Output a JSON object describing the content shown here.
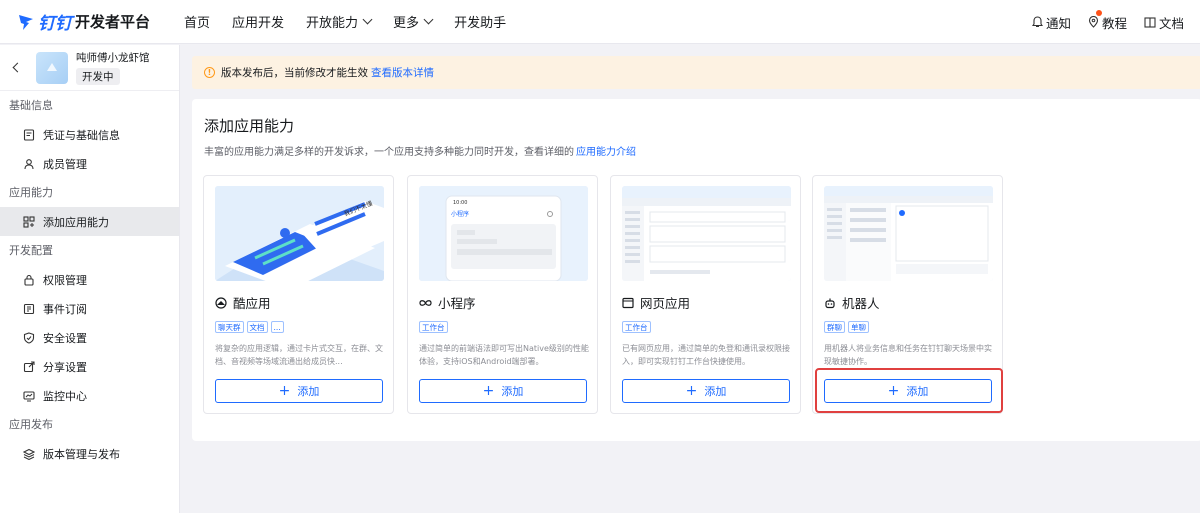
{
  "brand": {
    "name": "钉钉",
    "title": "开发者平台",
    "color": "#1f6bff"
  },
  "nav": {
    "items": [
      {
        "label": "首页",
        "dropdown": false
      },
      {
        "label": "应用开发",
        "dropdown": false
      },
      {
        "label": "开放能力",
        "dropdown": true
      },
      {
        "label": "更多",
        "dropdown": true
      },
      {
        "label": "开发助手",
        "dropdown": false
      }
    ],
    "right": {
      "notify": "通知",
      "tutorial": "教程",
      "docs": "文档"
    }
  },
  "app": {
    "name": "吨师傅小龙虾馆",
    "status": "开发中"
  },
  "sidebar": {
    "sections": [
      {
        "title": "基础信息",
        "items": [
          {
            "label": "凭证与基础信息",
            "icon": "credential-icon"
          },
          {
            "label": "成员管理",
            "icon": "member-icon"
          }
        ]
      },
      {
        "title": "应用能力",
        "items": [
          {
            "label": "添加应用能力",
            "icon": "grid-add-icon",
            "active": true
          }
        ]
      },
      {
        "title": "开发配置",
        "items": [
          {
            "label": "权限管理",
            "icon": "lock-icon"
          },
          {
            "label": "事件订阅",
            "icon": "subscribe-icon"
          },
          {
            "label": "安全设置",
            "icon": "shield-icon"
          },
          {
            "label": "分享设置",
            "icon": "share-icon"
          },
          {
            "label": "监控中心",
            "icon": "monitor-icon"
          }
        ]
      },
      {
        "title": "应用发布",
        "items": [
          {
            "label": "版本管理与发布",
            "icon": "layers-icon"
          }
        ]
      }
    ]
  },
  "notice": {
    "text": "版本发布后，当前修改才能生效",
    "link": "查看版本详情"
  },
  "main": {
    "title": "添加应用能力",
    "desc": "丰富的应用能力满足多样的开发诉求，一个应用支持多种能力同时开发，查看详细的",
    "desc_link": "应用能力介绍",
    "cards": [
      {
        "title": "酷应用",
        "icon": "cool-app-icon",
        "tags": [
          "聊天群",
          "文档",
          "..."
        ],
        "desc": "将复杂的应用逻辑，通过卡片式交互，在群、文档、音视频等场域流通出给成员快...",
        "button": "添加",
        "illustration": {
          "caption": "我们不太懂"
        }
      },
      {
        "title": "小程序",
        "icon": "mini-program-icon",
        "tags": [
          "工作台"
        ],
        "desc": "通过简单的前端语法即可写出Native级别的性能体验，支持iOS和Android端部署。",
        "button": "添加",
        "illustration": {
          "time": "10:00",
          "header": "小程序"
        }
      },
      {
        "title": "网页应用",
        "icon": "web-app-icon",
        "tags": [
          "工作台"
        ],
        "desc": "已有网页应用，通过简单的免登和通讯录权限接入，即可实现钉钉工作台快捷使用。",
        "button": "添加"
      },
      {
        "title": "机器人",
        "icon": "robot-icon",
        "tags": [
          "群聊",
          "单聊"
        ],
        "desc": "用机器人将业务信息和任务在钉钉聊天场景中实现敏捷协作。",
        "button": "添加",
        "highlighted": true
      }
    ]
  }
}
